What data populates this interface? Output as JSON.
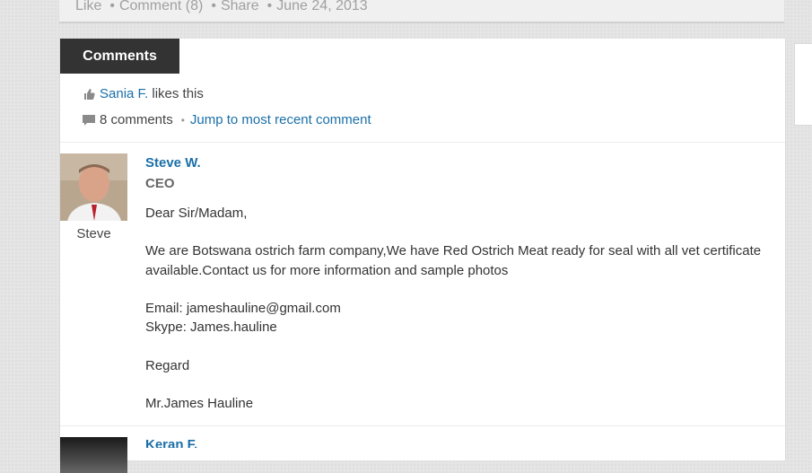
{
  "top_actions": {
    "like": "Like",
    "comment": "Comment (8)",
    "share": "Share",
    "date": "June 24, 2013"
  },
  "comments_section": {
    "tab_label": "Comments",
    "liker": "Sania F.",
    "likes_text": "likes this",
    "comment_count": "8 comments",
    "jump_link": "Jump to most recent comment"
  },
  "comment1": {
    "author": "Steve W.",
    "role": "CEO",
    "avatar_label": "Steve",
    "salutation": "Dear Sir/Madam,",
    "paragraph1": "We are Botswana ostrich farm company,We have Red Ostrich Meat ready for seal with all vet certificate available.Contact us for more information and sample photos",
    "email_line": "Email: jameshauline@gmail.com",
    "skype_line": "Skype: James.hauline",
    "regard": "Regard",
    "signature": "Mr.James Hauline"
  },
  "comment2": {
    "author": "Keran F."
  }
}
